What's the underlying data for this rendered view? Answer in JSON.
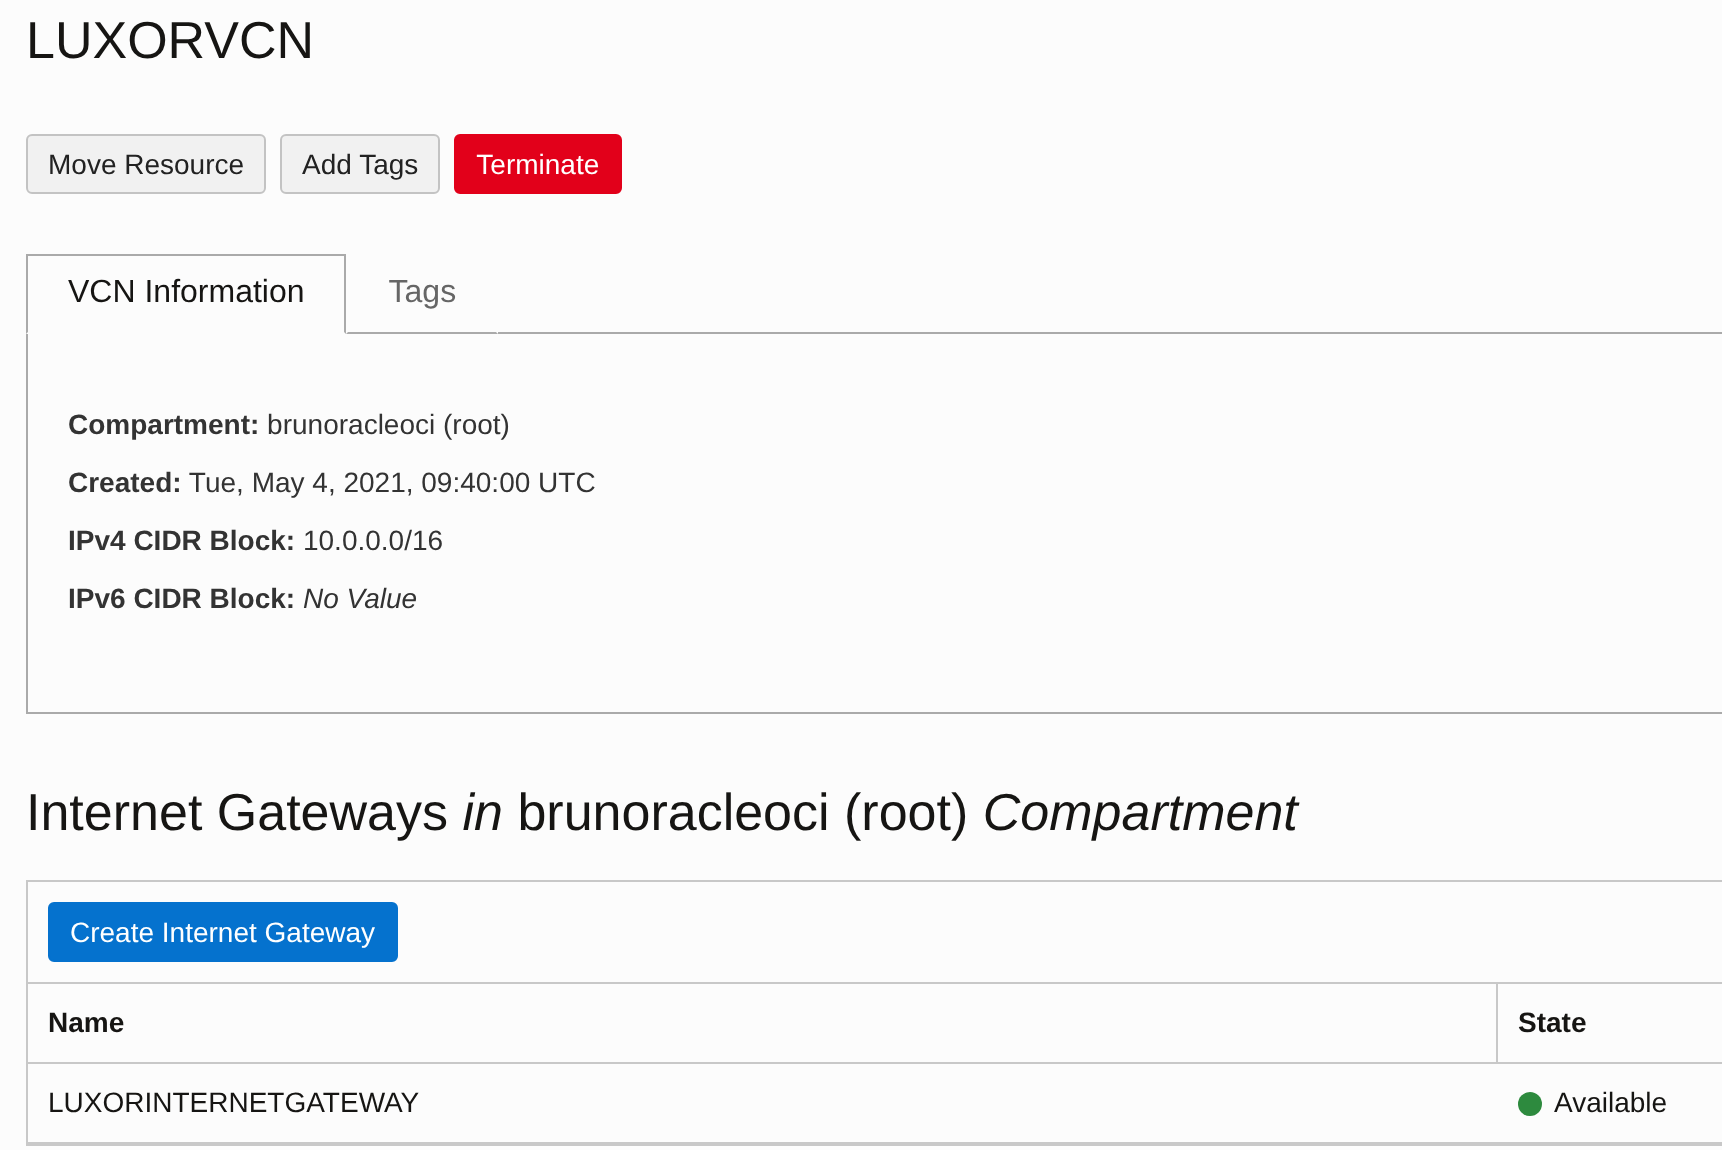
{
  "title": "LUXORVCN",
  "actions": [
    {
      "label": "Move Resource",
      "kind": "default"
    },
    {
      "label": "Add Tags",
      "kind": "default"
    },
    {
      "label": "Terminate",
      "kind": "danger"
    }
  ],
  "tabs": [
    {
      "label": "VCN Information",
      "selected": true
    },
    {
      "label": "Tags",
      "selected": false
    }
  ],
  "details": [
    "**Compartment:** brunoracleoci (root)",
    "**Created:** Tue, May 4, 2021, 09:40:00 UTC",
    "**IPv4 CIDR Block:** 10.0.0.0/16",
    "**IPv6 CIDR Block:** *No Value*"
  ],
  "section_title": "Internet Gateways *in* brunoracleoci (root) *Compartment*",
  "create_button": "Create Internet Gateway",
  "table": {
    "columns": [
      "Name",
      "State"
    ],
    "rows": [
      {
        "name": "LUXORINTERNETGATEWAY",
        "state": "Available",
        "color": "#2d8a3e"
      }
    ]
  }
}
